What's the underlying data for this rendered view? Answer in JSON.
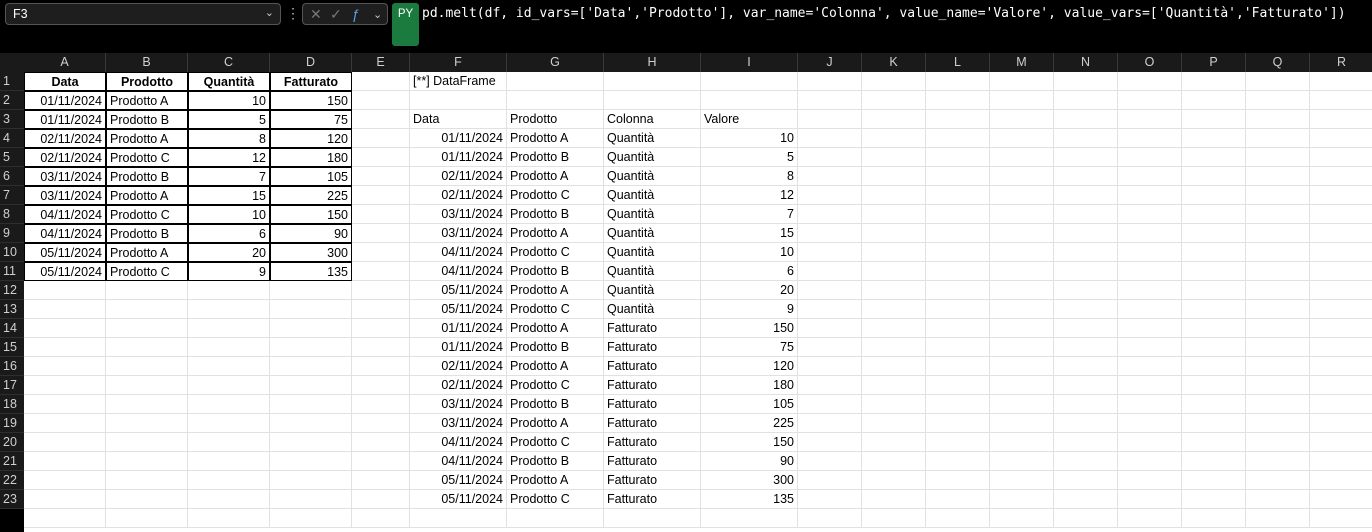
{
  "name_box": "F3",
  "formula_badge": "PY",
  "formula": "pd.melt(df, id_vars=['Data','Prodotto'], var_name='Colonna', value_name='Valore', value_vars=['Quantità','Fatturato'])",
  "columns": [
    "A",
    "B",
    "C",
    "D",
    "E",
    "F",
    "G",
    "H",
    "I",
    "J",
    "K",
    "L",
    "M",
    "N",
    "O",
    "P",
    "Q",
    "R"
  ],
  "rows": [
    "1",
    "2",
    "3",
    "4",
    "5",
    "6",
    "7",
    "8",
    "9",
    "10",
    "11",
    "12",
    "13",
    "14",
    "15",
    "16",
    "17",
    "18",
    "19",
    "20",
    "21",
    "22",
    "23"
  ],
  "source_table": {
    "headers": [
      "Data",
      "Prodotto",
      "Quantità",
      "Fatturato"
    ],
    "rows": [
      [
        "01/11/2024",
        "Prodotto A",
        "10",
        "150"
      ],
      [
        "01/11/2024",
        "Prodotto B",
        "5",
        "75"
      ],
      [
        "02/11/2024",
        "Prodotto A",
        "8",
        "120"
      ],
      [
        "02/11/2024",
        "Prodotto C",
        "12",
        "180"
      ],
      [
        "03/11/2024",
        "Prodotto B",
        "7",
        "105"
      ],
      [
        "03/11/2024",
        "Prodotto A",
        "15",
        "225"
      ],
      [
        "04/11/2024",
        "Prodotto C",
        "10",
        "150"
      ],
      [
        "04/11/2024",
        "Prodotto B",
        "6",
        "90"
      ],
      [
        "05/11/2024",
        "Prodotto A",
        "20",
        "300"
      ],
      [
        "05/11/2024",
        "Prodotto C",
        "9",
        "135"
      ]
    ]
  },
  "dataframe_label": "[**] DataFrame",
  "melt_table": {
    "headers": [
      "Data",
      "Prodotto",
      "Colonna",
      "Valore"
    ],
    "rows": [
      [
        "01/11/2024",
        "Prodotto A",
        "Quantità",
        "10"
      ],
      [
        "01/11/2024",
        "Prodotto B",
        "Quantità",
        "5"
      ],
      [
        "02/11/2024",
        "Prodotto A",
        "Quantità",
        "8"
      ],
      [
        "02/11/2024",
        "Prodotto C",
        "Quantità",
        "12"
      ],
      [
        "03/11/2024",
        "Prodotto B",
        "Quantità",
        "7"
      ],
      [
        "03/11/2024",
        "Prodotto A",
        "Quantità",
        "15"
      ],
      [
        "04/11/2024",
        "Prodotto C",
        "Quantità",
        "10"
      ],
      [
        "04/11/2024",
        "Prodotto B",
        "Quantità",
        "6"
      ],
      [
        "05/11/2024",
        "Prodotto A",
        "Quantità",
        "20"
      ],
      [
        "05/11/2024",
        "Prodotto C",
        "Quantità",
        "9"
      ],
      [
        "01/11/2024",
        "Prodotto A",
        "Fatturato",
        "150"
      ],
      [
        "01/11/2024",
        "Prodotto B",
        "Fatturato",
        "75"
      ],
      [
        "02/11/2024",
        "Prodotto A",
        "Fatturato",
        "120"
      ],
      [
        "02/11/2024",
        "Prodotto C",
        "Fatturato",
        "180"
      ],
      [
        "03/11/2024",
        "Prodotto B",
        "Fatturato",
        "105"
      ],
      [
        "03/11/2024",
        "Prodotto A",
        "Fatturato",
        "225"
      ],
      [
        "04/11/2024",
        "Prodotto C",
        "Fatturato",
        "150"
      ],
      [
        "04/11/2024",
        "Prodotto B",
        "Fatturato",
        "90"
      ],
      [
        "05/11/2024",
        "Prodotto A",
        "Fatturato",
        "300"
      ],
      [
        "05/11/2024",
        "Prodotto C",
        "Fatturato",
        "135"
      ]
    ]
  },
  "colors": {
    "python_badge": "#1b7a3e",
    "header_bg": "#1a1a1a"
  }
}
